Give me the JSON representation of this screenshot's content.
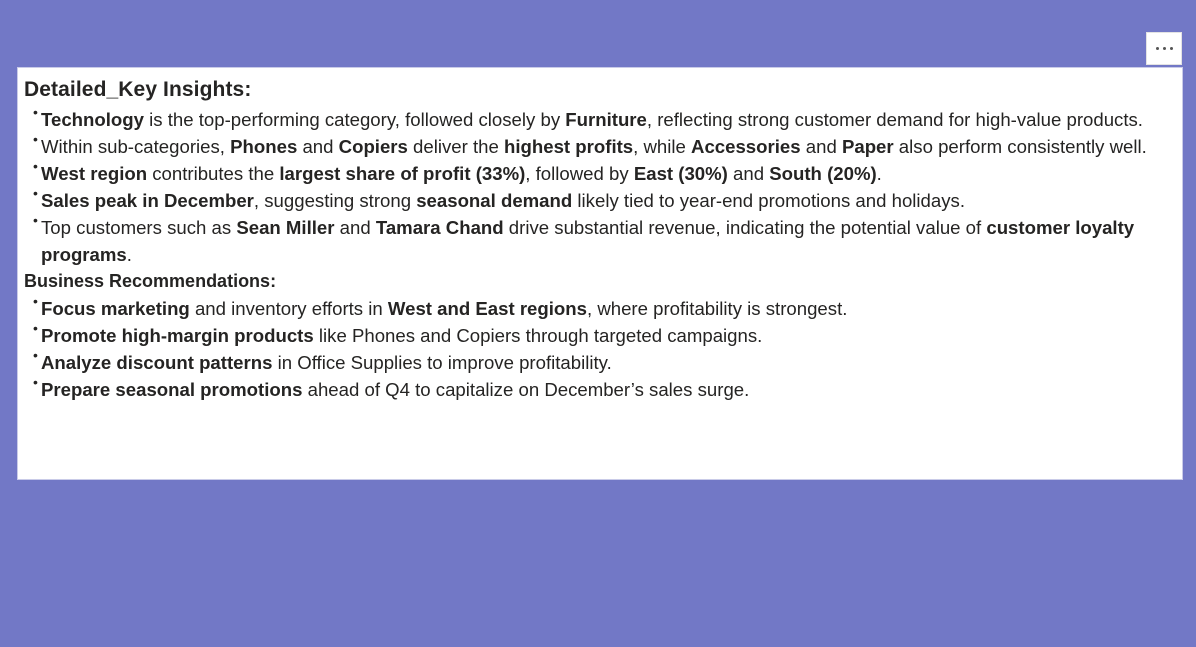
{
  "menu": {
    "more_options_icon": "ellipsis-icon"
  },
  "card": {
    "title": "Detailed_Key Insights:",
    "insights": [
      [
        {
          "t": "Technology",
          "b": true
        },
        {
          "t": " is the top-performing category, followed closely by ",
          "b": false
        },
        {
          "t": "Furniture",
          "b": true
        },
        {
          "t": ", reflecting strong customer demand for high-value products.",
          "b": false
        }
      ],
      [
        {
          "t": "Within sub-categories, ",
          "b": false
        },
        {
          "t": "Phones",
          "b": true
        },
        {
          "t": " and ",
          "b": false
        },
        {
          "t": "Copiers",
          "b": true
        },
        {
          "t": " deliver the ",
          "b": false
        },
        {
          "t": "highest profits",
          "b": true
        },
        {
          "t": ", while ",
          "b": false
        },
        {
          "t": "Accessories",
          "b": true
        },
        {
          "t": " and ",
          "b": false
        },
        {
          "t": "Paper",
          "b": true
        },
        {
          "t": " also perform consistently well.",
          "b": false
        }
      ],
      [
        {
          "t": "West region",
          "b": true
        },
        {
          "t": " contributes the ",
          "b": false
        },
        {
          "t": "largest share of profit (33%)",
          "b": true
        },
        {
          "t": ", followed by ",
          "b": false
        },
        {
          "t": "East (30%)",
          "b": true
        },
        {
          "t": " and ",
          "b": false
        },
        {
          "t": "South (20%)",
          "b": true
        },
        {
          "t": ".",
          "b": false
        }
      ],
      [
        {
          "t": "Sales peak in December",
          "b": true
        },
        {
          "t": ", suggesting strong ",
          "b": false
        },
        {
          "t": "seasonal demand",
          "b": true
        },
        {
          "t": " likely tied to year-end promotions and holidays.",
          "b": false
        }
      ],
      [
        {
          "t": "Top customers such as ",
          "b": false
        },
        {
          "t": "Sean Miller",
          "b": true
        },
        {
          "t": " and ",
          "b": false
        },
        {
          "t": "Tamara Chand",
          "b": true
        },
        {
          "t": " drive substantial revenue, indicating the potential value of ",
          "b": false
        },
        {
          "t": "customer loyalty programs",
          "b": true
        },
        {
          "t": ".",
          "b": false
        }
      ]
    ],
    "recommendations_title": "Business Recommendations:",
    "recommendations": [
      [
        {
          "t": "Focus marketing",
          "b": true
        },
        {
          "t": " and inventory efforts in ",
          "b": false
        },
        {
          "t": "West and East regions",
          "b": true
        },
        {
          "t": ", where profitability is strongest.",
          "b": false
        }
      ],
      [
        {
          "t": "Promote high-margin products",
          "b": true
        },
        {
          "t": " like Phones and Copiers through targeted campaigns.",
          "b": false
        }
      ],
      [
        {
          "t": "Analyze discount patterns",
          "b": true
        },
        {
          "t": " in Office Supplies to improve profitability.",
          "b": false
        }
      ],
      [
        {
          "t": "Prepare seasonal promotions",
          "b": true
        },
        {
          "t": " ahead of Q4 to capitalize on December’s sales surge.",
          "b": false
        }
      ]
    ]
  },
  "colors": {
    "canvas_background": "#7278c6",
    "card_background": "#ffffff",
    "text": "#252423"
  }
}
